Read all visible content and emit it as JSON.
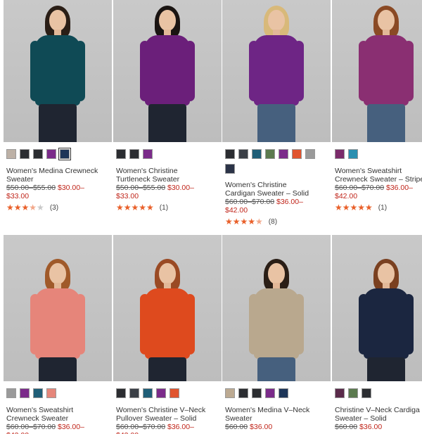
{
  "products": [
    {
      "name_line1": "Women's Medina Crewneck",
      "name_line2": "Sweater",
      "price_old": "$50.00–$55.00",
      "price_new": "$30.00–",
      "price_new2": "$33.00",
      "rating_value": 3.5,
      "stars_on": "★★★",
      "stars_half": "★",
      "stars_off": "★",
      "count": "(3)",
      "swatches": [
        "#bdb1a6",
        "#2b2d31",
        "#2b2d31",
        "#7b2b8a",
        "#1d3558"
      ],
      "top_color": "#0f4a55",
      "pants": "dark"
    },
    {
      "name_line1": "Women's Christine",
      "name_line2": "Turtleneck Sweater",
      "price_old": "$50.00–$55.00",
      "price_new": "$30.00–",
      "price_new2": "$33.00",
      "rating_value": 5,
      "stars_on": "★★★★★",
      "stars_half": "",
      "stars_off": "",
      "count": "(1)",
      "swatches": [
        "#2b2d31",
        "#2b2d31",
        "#7b2b8a"
      ],
      "top_color": "#6b1f7a",
      "pants": "dark"
    },
    {
      "name_line1": "Women's Christine",
      "name_line2": "Cardigan Sweater – Solid",
      "price_old": "$60.00–$70.00",
      "price_new": "$36.00–",
      "price_new2": "$42.00",
      "rating_value": 4.5,
      "stars_on": "★★★★",
      "stars_half": "★",
      "stars_off": "",
      "count": "(8)",
      "swatches": [
        "#2b2d31",
        "#3a3f46",
        "#1f5e77",
        "#5b7a4e",
        "#7b2b8a",
        "#e0542e",
        "#9a9a9a",
        "#2b3347"
      ],
      "top_color": "#6e2585",
      "pants": "jeans"
    },
    {
      "name_line1": "Women's Sweatshirt",
      "name_line2": "Crewneck Sweater – Stripe",
      "price_old": "$60.00–$70.00",
      "price_new": "$36.00–",
      "price_new2": "$42.00",
      "rating_value": 5,
      "stars_on": "★★★★★",
      "stars_half": "",
      "stars_off": "",
      "count": "(1)",
      "swatches": [
        "#7b2b6a",
        "#2b8fb0"
      ],
      "top_color": "#8a2f72",
      "pants": "jeans"
    },
    {
      "name_line1": "Women's Sweatshirt",
      "name_line2": "Crewneck Sweater",
      "price_old": "$60.00–$70.00",
      "price_new": "$36.00–",
      "price_new2": "$42.00",
      "swatches": [
        "#9a9a9a",
        "#7b2b8a",
        "#1f5e77",
        "#e5867a"
      ],
      "top_color": "#e6857a",
      "pants": "dark"
    },
    {
      "name_line1": "Women's Christine V–Neck",
      "name_line2": "Pullover Sweater – Solid",
      "price_old": "$60.00–$70.00",
      "price_new": "$36.00–",
      "price_new2": "$42.00",
      "swatches": [
        "#2b2d31",
        "#3a3f46",
        "#1f5e77",
        "#7b2b8a",
        "#e0542e"
      ],
      "top_color": "#de4a1e",
      "pants": "dark"
    },
    {
      "name_line1": "Women's Medina V–Neck",
      "name_line2": "Sweater",
      "price_old": "$60.00",
      "price_new": "$36.00",
      "price_new2": "",
      "swatches": [
        "#bcaa92",
        "#2b2d31",
        "#2b2d31",
        "#7b2b8a",
        "#1d3558"
      ],
      "top_color": "#b9a88e",
      "pants": "jeans"
    },
    {
      "name_line1": "Christine V–Neck Cardiga",
      "name_line2": "Sweater – Solid",
      "price_old": "$60.00",
      "price_new": "$36.00",
      "price_new2": "",
      "swatches": [
        "#5a2a4a",
        "#5b7a4e",
        "#2b2d31"
      ],
      "top_color": "#1b2640",
      "pants": "dark"
    }
  ]
}
